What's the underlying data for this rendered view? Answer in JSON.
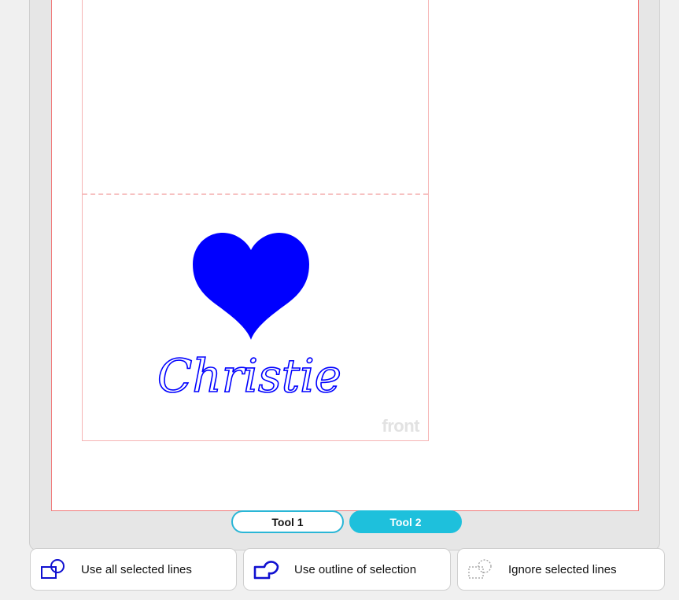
{
  "canvas": {
    "card_label": "front",
    "design_text": "Christie",
    "design_color": "#0000ff"
  },
  "tools": {
    "tool1_label": "Tool 1",
    "tool2_label": "Tool 2",
    "active": "Tool 2"
  },
  "options": {
    "use_all_label": "Use all selected lines",
    "use_outline_label": "Use outline of selection",
    "ignore_label": "Ignore selected lines"
  },
  "colors": {
    "accent": "#1ec0dc",
    "mat_border": "#f07a7a",
    "icon_blue": "#1010d0"
  }
}
